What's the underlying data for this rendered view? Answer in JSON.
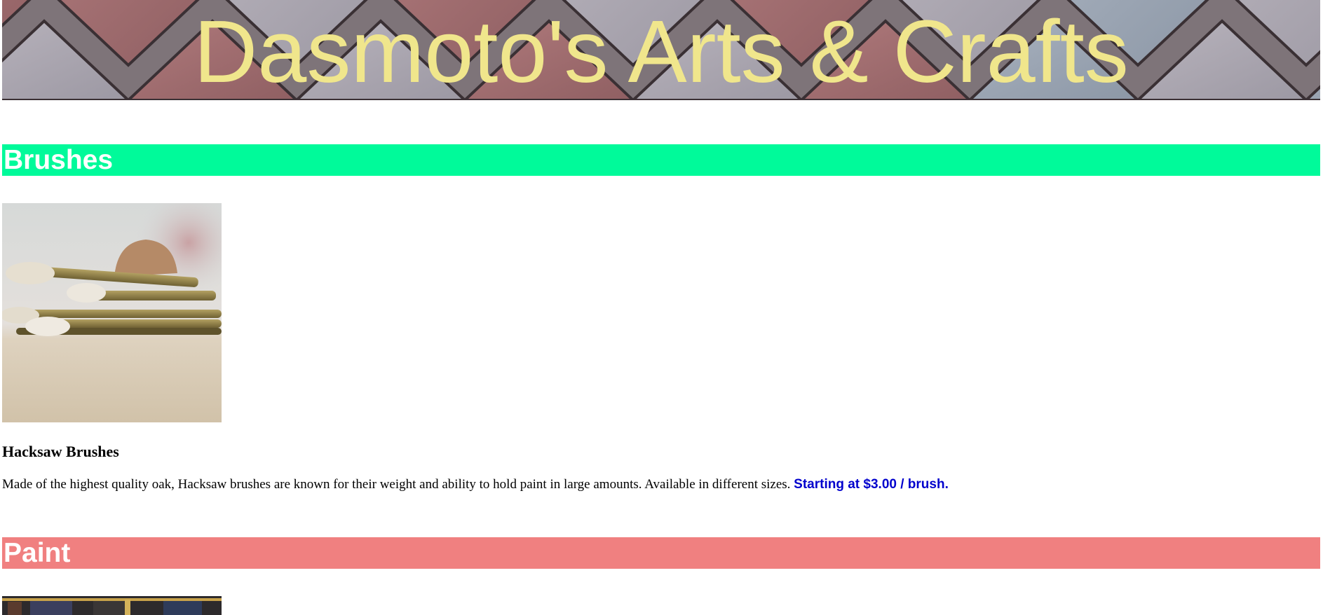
{
  "banner": {
    "title": "Dasmoto's Arts & Crafts",
    "title_color": "#f0e68c"
  },
  "sections": [
    {
      "header": "Brushes",
      "header_color": "#00fa9a",
      "product": {
        "name": "Hacksaw Brushes",
        "description": "Made of the highest quality oak, Hacksaw brushes are known for their weight and ability to hold paint in large amounts. Available in different sizes.",
        "price": "Starting at $3.00 / brush.",
        "price_color": "#0000cd",
        "image_icon": "brushes-photo"
      }
    },
    {
      "header": "Paint",
      "header_color": "#f08080",
      "product": {
        "image_icon": "paint-photo"
      }
    }
  ]
}
